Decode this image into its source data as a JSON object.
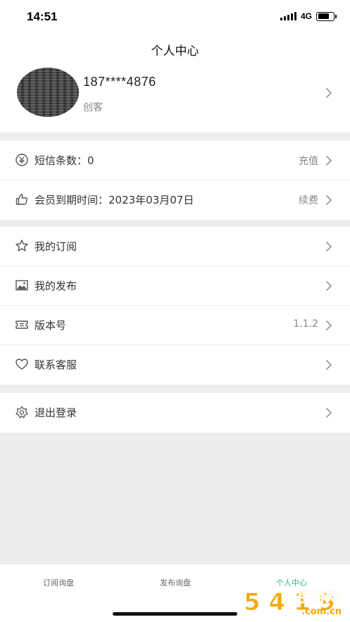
{
  "status_bar": {
    "time": "14:51",
    "network": "4G",
    "battery_level": 0.75
  },
  "header": {
    "title": "个人中心"
  },
  "profile": {
    "phone": "187****4876",
    "role": "创客"
  },
  "account": [
    {
      "icon": "yen-circle-icon",
      "label": "短信条数：0",
      "value": "充值"
    },
    {
      "icon": "thumbs-up-icon",
      "label": "会员到期时间：2023年03月07日",
      "value": "续费"
    }
  ],
  "menu": [
    {
      "icon": "star-icon",
      "label": "我的订阅",
      "value": ""
    },
    {
      "icon": "image-icon",
      "label": "我的发布",
      "value": ""
    },
    {
      "icon": "ticket-icon",
      "label": "版本号",
      "value": "1.1.2"
    },
    {
      "icon": "heart-icon",
      "label": "联系客服",
      "value": ""
    }
  ],
  "logout": {
    "icon": "flower-icon",
    "label": "退出登录"
  },
  "tabs": [
    {
      "label": "订阅询盘",
      "active": false
    },
    {
      "label": "发布询盘",
      "active": false
    },
    {
      "label": "个人中心",
      "active": true
    }
  ],
  "watermark": {
    "main": "手游网",
    "site": "5 4 1 9",
    "domain": ".com.cn"
  },
  "colors": {
    "accent": "#2bb673",
    "background": "#ededed",
    "watermark": "#f2a900"
  }
}
